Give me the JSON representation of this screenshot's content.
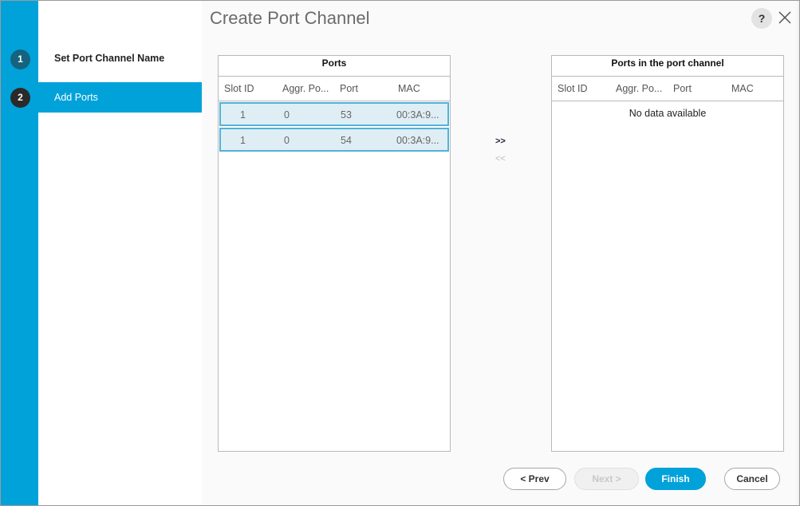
{
  "dialog": {
    "title": "Create Port Channel",
    "help_label": "?"
  },
  "steps": [
    {
      "number": "1",
      "label": "Set Port Channel Name"
    },
    {
      "number": "2",
      "label": "Add Ports"
    }
  ],
  "ports_table": {
    "title": "Ports",
    "columns": [
      "Slot ID",
      "Aggr. Po...",
      "Port",
      "MAC"
    ],
    "rows": [
      {
        "slot_id": "1",
        "aggr_port": "0",
        "port": "53",
        "mac": "00:3A:9..."
      },
      {
        "slot_id": "1",
        "aggr_port": "0",
        "port": "54",
        "mac": "00:3A:9..."
      }
    ]
  },
  "channel_table": {
    "title": "Ports in the port channel",
    "columns": [
      "Slot ID",
      "Aggr. Po...",
      "Port",
      "MAC"
    ],
    "empty_text": "No data available"
  },
  "transfer": {
    "add_label": ">>",
    "remove_label": "<<"
  },
  "buttons": {
    "prev": "< Prev",
    "next": "Next >",
    "finish": "Finish",
    "cancel": "Cancel"
  },
  "colors": {
    "accent": "#00a2d9",
    "selected_row_bg": "#dfeef4",
    "selected_row_border": "#4fb3d9"
  }
}
